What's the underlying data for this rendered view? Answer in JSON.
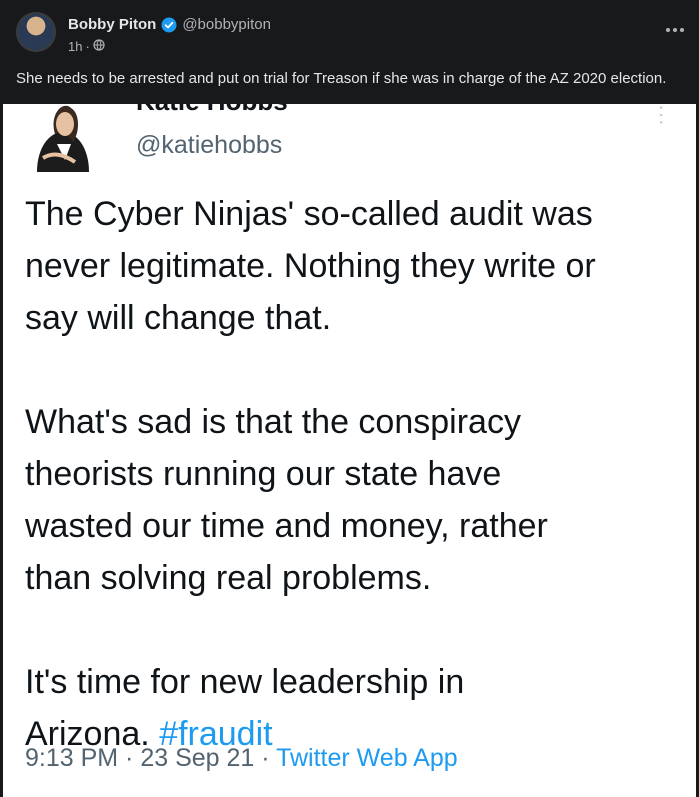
{
  "post": {
    "author_name": "Bobby Piton",
    "author_handle": "@bobbypiton",
    "time": "1h",
    "separator": "·",
    "text": "She needs to be arrested and put on trial for Treason if she was in charge of the AZ 2020 election.",
    "icons": [
      "verified-badge-icon",
      "globe-icon",
      "more-options-icon"
    ],
    "colors": {
      "verified": "#1d9bf0",
      "background": "#18191a"
    }
  },
  "embedded_tweet": {
    "name": "Katie Hobbs",
    "handle": "@katiehobbs",
    "paragraphs": [
      [
        "The Cyber Ninjas' so-called audit was",
        "never legitimate. Nothing they write or",
        "say will change that."
      ],
      [
        "What's sad is that the conspiracy",
        "theorists running our state have",
        "wasted our time and money, rather",
        "than solving real problems."
      ],
      [
        "It's time for new leadership in"
      ]
    ],
    "last_line_text": "Arizona.",
    "hashtag": "#fraudit",
    "timestamp": "9:13 PM · 23 Sep 21 ·",
    "source_app": "Twitter Web App",
    "colors": {
      "link": "#1d9bf0",
      "text": "#0f1419",
      "muted": "#536471"
    }
  }
}
